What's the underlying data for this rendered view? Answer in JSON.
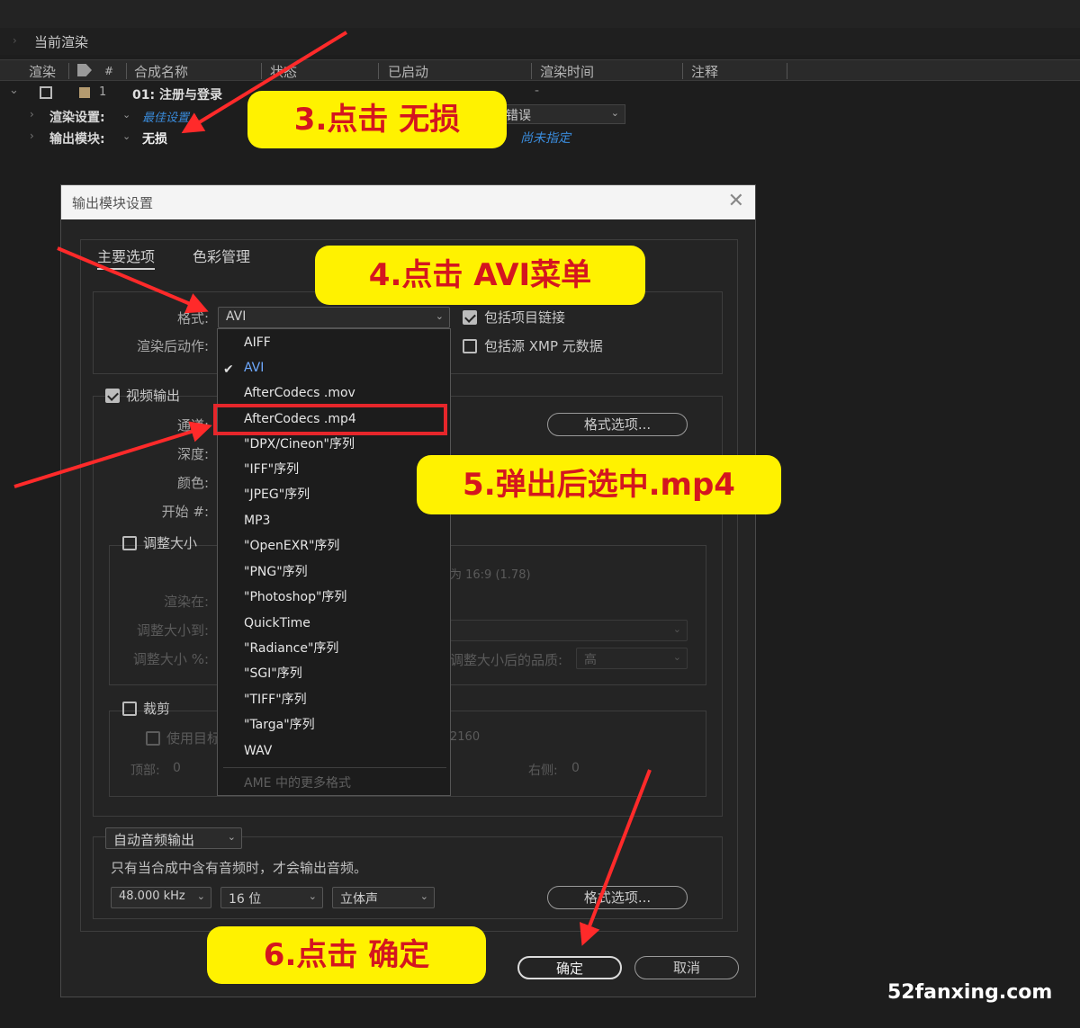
{
  "render_queue": {
    "section_title": "当前渲染",
    "columns": [
      "渲染",
      "#",
      "合成名称",
      "状态",
      "已启动",
      "渲染时间",
      "注释"
    ],
    "item": {
      "number": "1",
      "comp_name": "01: 注册与登录",
      "started": "-"
    },
    "render_settings_label": "渲染设置:",
    "render_settings_value": "最佳设置",
    "output_module_label": "输出模块:",
    "output_module_value": "无损",
    "log_value": "错误",
    "output_to_value": "尚未指定"
  },
  "dialog": {
    "title": "输出模块设置",
    "tabs": [
      "主要选项",
      "色彩管理"
    ],
    "format_label": "格式:",
    "format_value": "AVI",
    "post_render_label": "渲染后动作:",
    "include_project_link": "包括项目链接",
    "include_xmp": "包括源 XMP 元数据",
    "video_output": "视频输出",
    "channels_label": "通道:",
    "depth_label": "深度:",
    "color_label": "颜色:",
    "start_label": "开始 #:",
    "format_options_btn": "格式选项...",
    "resize": "调整大小",
    "render_at": "渲染在:",
    "resize_to": "调整大小到:",
    "resize_pct": "调整大小 %:",
    "aspect_text": "为 16:9 (1.78)",
    "resize_quality_label": "调整大小后的品质:",
    "resize_quality_value": "高",
    "crop": "裁剪",
    "use_region": "使用目标区域",
    "crop_size_text": "2160",
    "top_label": "顶部:",
    "top_value": "0",
    "right_label": "右侧:",
    "right_value": "0",
    "audio_mode": "自动音频输出",
    "audio_note": "只有当合成中含有音频时，才会输出音频。",
    "sample_rate": "48.000 kHz",
    "bit_depth": "16 位",
    "channels_audio": "立体声",
    "audio_format_btn": "格式选项...",
    "ok": "确定",
    "cancel": "取消"
  },
  "format_menu": {
    "items": [
      "AIFF",
      "AVI",
      "AfterCodecs .mov",
      "AfterCodecs .mp4",
      "\"DPX/Cineon\"序列",
      "\"IFF\"序列",
      "\"JPEG\"序列",
      "MP3",
      "\"OpenEXR\"序列",
      "\"PNG\"序列",
      "\"Photoshop\"序列",
      "QuickTime",
      "\"Radiance\"序列",
      "\"SGI\"序列",
      "\"TIFF\"序列",
      "\"Targa\"序列",
      "WAV"
    ],
    "selected": "AVI",
    "highlighted": "AfterCodecs .mp4",
    "more": "AME 中的更多格式"
  },
  "annotations": {
    "step3": "3.点击 无损",
    "step4": "4.点击 AVI菜单",
    "step5": "5.弹出后选中.mp4",
    "step6": "6.点击 确定"
  },
  "watermark": "52fanxing.com",
  "colors": {
    "highlight_box": "#e6262b",
    "bubble": "#fff200",
    "bubble_text": "#d4161f",
    "link": "#3a8bdb",
    "menu_selected": "#6ea9ff"
  }
}
